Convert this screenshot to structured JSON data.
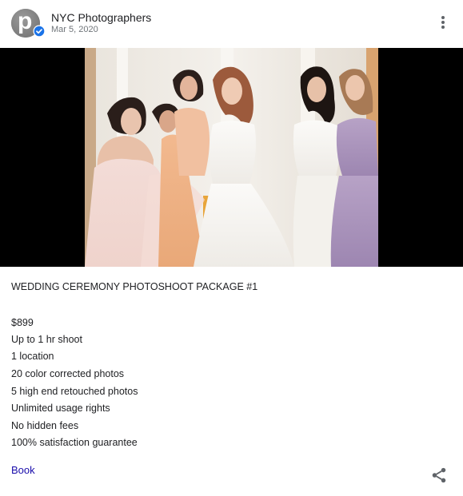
{
  "header": {
    "avatar_letter": "p",
    "business_name": "NYC Photographers",
    "date": "Mar 5, 2020"
  },
  "post": {
    "title": "WEDDING CEREMONY PHOTOSHOOT PACKAGE #1",
    "lines": [
      "$899",
      "Up to 1 hr shoot",
      "1 location",
      "20 color corrected photos",
      "5 high end retouched photos",
      "Unlimited usage rights",
      "No hidden fees",
      "100% satisfaction guarantee"
    ],
    "cta_label": "Book"
  },
  "icons": {
    "more": "more-vert-icon",
    "share": "share-icon",
    "verified": "verified-badge-icon"
  },
  "colors": {
    "link": "#1a0dab",
    "verified": "#1a73e8",
    "photo_letterbox": "#000000"
  }
}
